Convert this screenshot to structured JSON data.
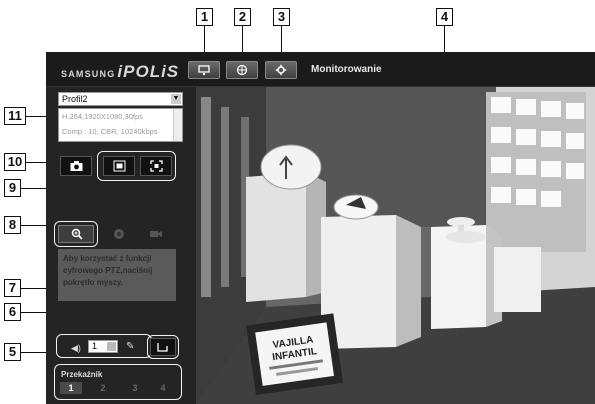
{
  "callouts": [
    "1",
    "2",
    "3",
    "4",
    "5",
    "6",
    "7",
    "8",
    "9",
    "10",
    "11"
  ],
  "header": {
    "brand": "SAMSUNG",
    "product": "iPOLiS",
    "title": "Monitorowanie",
    "buttons": [
      {
        "icon": "monitor-icon"
      },
      {
        "icon": "playback-icon"
      },
      {
        "icon": "settings-icon"
      }
    ]
  },
  "sidebar": {
    "profile_selected": "Profil2",
    "profile_info": [
      "H.264,1920X1080,30fps",
      "Comp : 10, CBR, 10240kbps"
    ],
    "ptz_help": "Aby korzystać z funkcji cyfrowego PTZ,naciśnij pokrętło myszy.",
    "audio_channel": "1",
    "relay_title": "Przekaźnik",
    "relays": [
      "1",
      "2",
      "3",
      "4"
    ],
    "active_relay": "1"
  },
  "video": {
    "sign_lines": [
      "VAJILLA",
      "INFANTIL"
    ]
  }
}
